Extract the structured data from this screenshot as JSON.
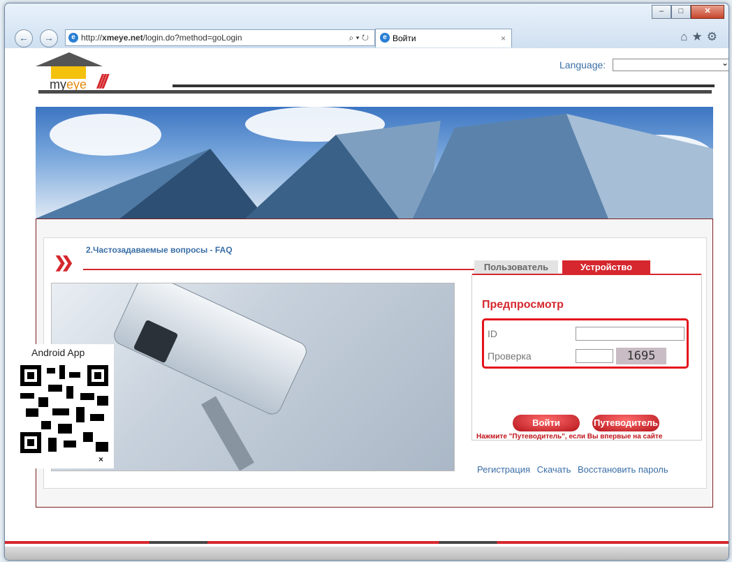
{
  "browser": {
    "url_host": "http://",
    "url_domain": "xmeye.net",
    "url_path": "/login.do?method=goLogin",
    "address_controls": "⌕ ▾ ↻",
    "tab_title": "Войти",
    "tab_close": "×",
    "min_label": "–",
    "max_label": "□",
    "close_label": "✕",
    "back_label": "←",
    "forward_label": "→",
    "tools": "⌂★⚙"
  },
  "header": {
    "language_label": "Language:",
    "logo_text_my": "my",
    "logo_text_eye": "eye"
  },
  "main": {
    "faq_link": "2.Частозадаваемые вопросы - FAQ",
    "tab_user": "Пользователь",
    "tab_device": "Устройство",
    "panel_title": "Предпросмотр",
    "id_label": "ID",
    "check_label": "Проверка",
    "captcha": "1695",
    "login_button": "Войти",
    "guide_button": "Путеводитель",
    "hint": "Нажмите \"Путеводитель\", если Вы впервые на сайте",
    "link_register": "Регистрация",
    "link_download": "Скачать",
    "link_restore": "Восстановить пароль"
  },
  "android_popup": {
    "label": "Android App",
    "close": "×"
  },
  "colors": {
    "accent_red": "#d5272d",
    "link_blue": "#3a6ea5"
  }
}
